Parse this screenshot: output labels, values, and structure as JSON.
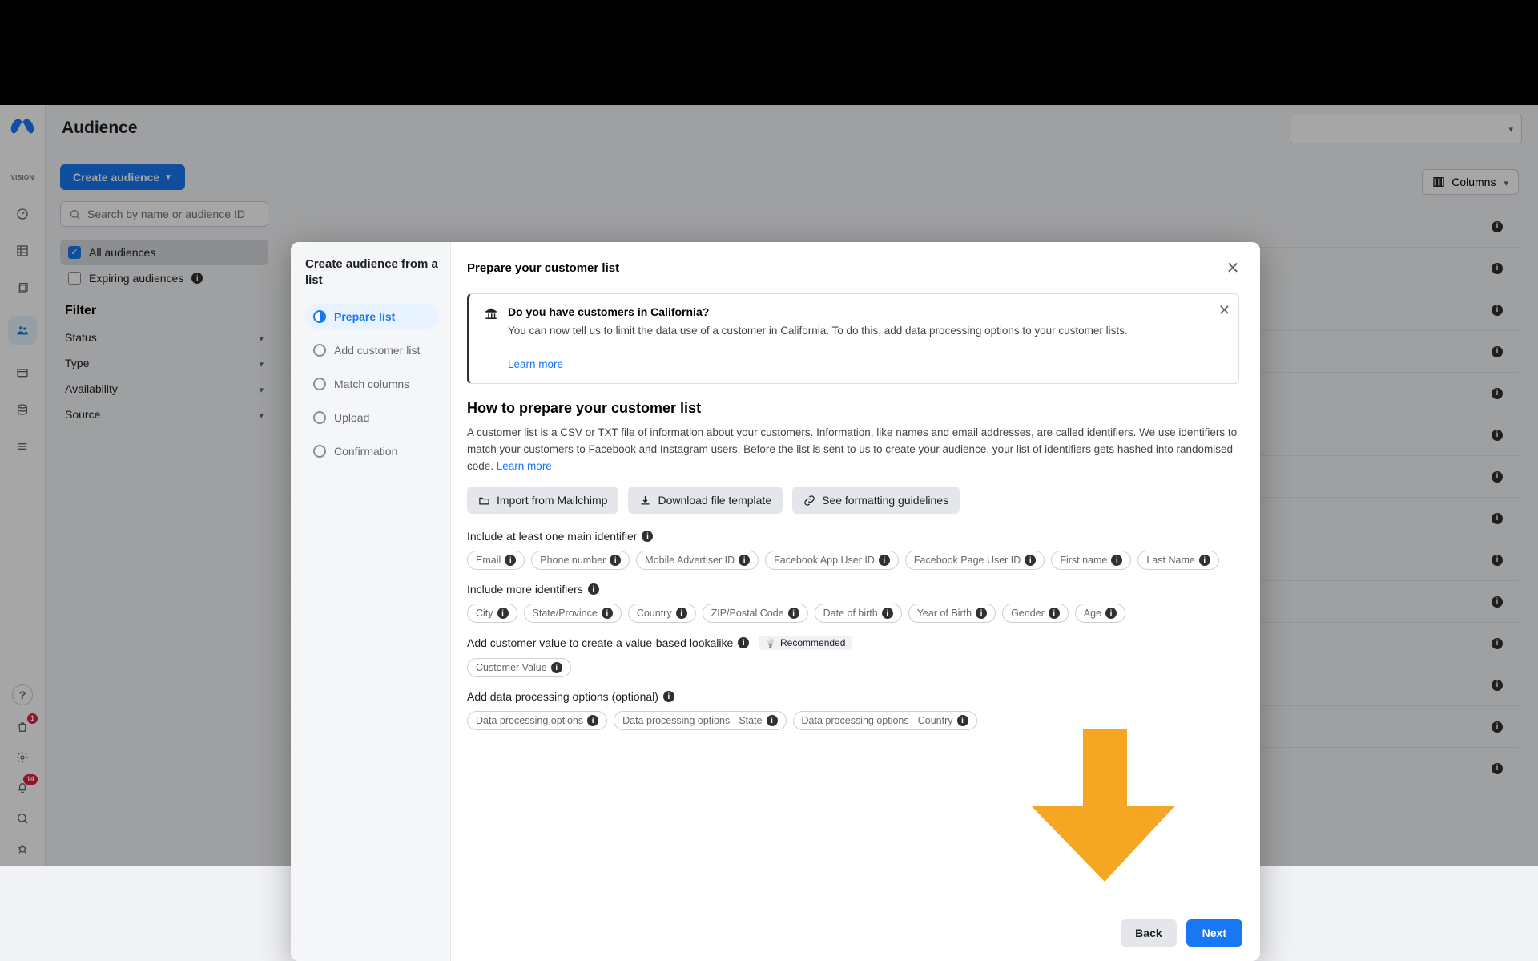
{
  "header": {
    "title": "Audience",
    "columns_label": "Columns"
  },
  "sidebar": {
    "create_label": "Create audience",
    "search_placeholder": "Search by name or audience ID",
    "all": "All audiences",
    "expiring": "Expiring audiences",
    "filter_heading": "Filter",
    "filters": [
      "Status",
      "Type",
      "Availability",
      "Source"
    ]
  },
  "rail": {
    "badge_1": "1",
    "badge_14": "14",
    "vision": "VISION"
  },
  "modal": {
    "left_title": "Create audience from a list",
    "steps": [
      "Prepare list",
      "Add customer list",
      "Match columns",
      "Upload",
      "Confirmation"
    ],
    "title": "Prepare your customer list",
    "notice": {
      "heading": "Do you have customers in California?",
      "body": "You can now tell us to limit the data use of a customer in California. To do this, add data processing options to your customer lists.",
      "learn": "Learn more"
    },
    "section_h": "How to prepare your customer list",
    "desc_1": "A customer list is a CSV or TXT file of information about your customers. Information, like names and email addresses, are called identifiers. We use identifiers to match your customers to Facebook and Instagram users. Before the list is sent to us to create your audience, your list of identifiers gets hashed into randomised code. ",
    "learn_more": "Learn more",
    "actions": {
      "mailchimp": "Import from Mailchimp",
      "download": "Download file template",
      "guidelines": "See formatting guidelines"
    },
    "label_main": "Include at least one main identifier",
    "chips_main": [
      "Email",
      "Phone number",
      "Mobile Advertiser ID",
      "Facebook App User ID",
      "Facebook Page User ID",
      "First name",
      "Last Name"
    ],
    "label_more": "Include more identifiers",
    "chips_more": [
      "City",
      "State/Province",
      "Country",
      "ZIP/Postal Code",
      "Date of birth",
      "Year of Birth",
      "Gender",
      "Age"
    ],
    "label_value": "Add customer value to create a value-based lookalike",
    "recommended": "Recommended",
    "chips_value": [
      "Customer Value"
    ],
    "label_dpo": "Add data processing options (optional)",
    "chips_dpo": [
      "Data processing options",
      "Data processing options - State",
      "Data processing options - Country"
    ],
    "footer": {
      "back": "Back",
      "next": "Next"
    }
  }
}
